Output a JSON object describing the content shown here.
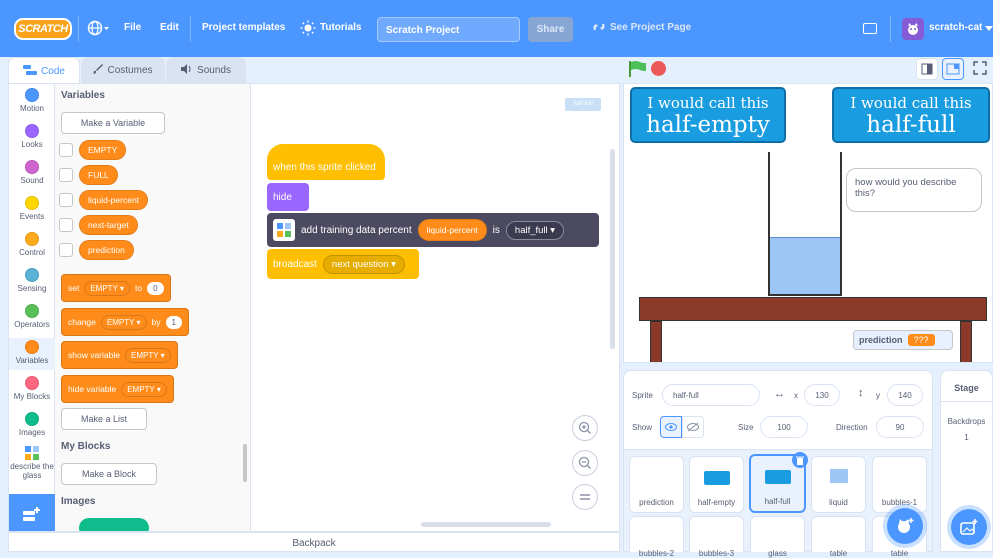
{
  "menubar": {
    "logo": "SCRATCH",
    "file": "File",
    "edit": "Edit",
    "templates": "Project templates",
    "tutorials": "Tutorials",
    "project_title": "Scratch Project",
    "share": "Share",
    "see_project": "See Project Page",
    "username": "scratch-cat"
  },
  "tabs": {
    "code": "Code",
    "costumes": "Costumes",
    "sounds": "Sounds"
  },
  "categories": [
    {
      "label": "Motion",
      "color": "#4c97ff"
    },
    {
      "label": "Looks",
      "color": "#9966ff"
    },
    {
      "label": "Sound",
      "color": "#cf63cf"
    },
    {
      "label": "Events",
      "color": "#ffd500"
    },
    {
      "label": "Control",
      "color": "#ffab19"
    },
    {
      "label": "Sensing",
      "color": "#5cb1d6"
    },
    {
      "label": "Operators",
      "color": "#59c059"
    },
    {
      "label": "Variables",
      "color": "#ff8c1a"
    },
    {
      "label": "My Blocks",
      "color": "#ff6680"
    },
    {
      "label": "Images",
      "color": "#0fbd8c"
    },
    {
      "label": "describe the glass",
      "color": "#4c97ff"
    }
  ],
  "flyout": {
    "variables_heading": "Variables",
    "make_variable": "Make a Variable",
    "vars": [
      "EMPTY",
      "FULL",
      "liquid-percent",
      "next-target",
      "prediction"
    ],
    "set_label": "set",
    "set_var": "EMPTY",
    "to_label": "to",
    "set_value": "0",
    "change_label": "change",
    "change_var": "EMPTY",
    "by_label": "by",
    "change_value": "1",
    "show_label": "show variable",
    "show_var": "EMPTY",
    "hide_label": "hide variable",
    "hide_var": "EMPTY",
    "make_list": "Make a List",
    "myblocks_heading": "My Blocks",
    "make_block": "Make a Block",
    "images_heading": "Images"
  },
  "script": {
    "hat": "when this sprite clicked",
    "hide": "hide",
    "training": "add training data percent",
    "training_var": "liquid-percent",
    "is_label": "is",
    "training_label": "half_full",
    "broadcast": "broadcast",
    "broadcast_msg": "next question",
    "sprite_tag": "half-full"
  },
  "stage": {
    "sign_left_l1": "I would call this",
    "sign_left_l2": "half-empty",
    "sign_right_l1": "I would call this",
    "sign_right_l2": "half-full",
    "bubble": "how would you describe this?",
    "monitor_label": "prediction",
    "monitor_value": "???",
    "water_color": "#9ec6f5",
    "table_color": "#8b3a2a"
  },
  "sprite_info": {
    "sprite_label": "Sprite",
    "sprite_name": "half-full",
    "x_label": "x",
    "x_value": "130",
    "y_label": "y",
    "y_value": "140",
    "show_label": "Show",
    "size_label": "Size",
    "size_value": "100",
    "direction_label": "Direction",
    "direction_value": "90"
  },
  "sprites": [
    "prediction",
    "half-empty",
    "half-full",
    "liquid",
    "bubbles-1",
    "bubbles-2",
    "bubbles-3",
    "glass",
    "table",
    "table"
  ],
  "stage_panel": {
    "title": "Stage",
    "backdrops_label": "Backdrops",
    "backdrops_count": "1"
  },
  "backpack": "Backpack"
}
